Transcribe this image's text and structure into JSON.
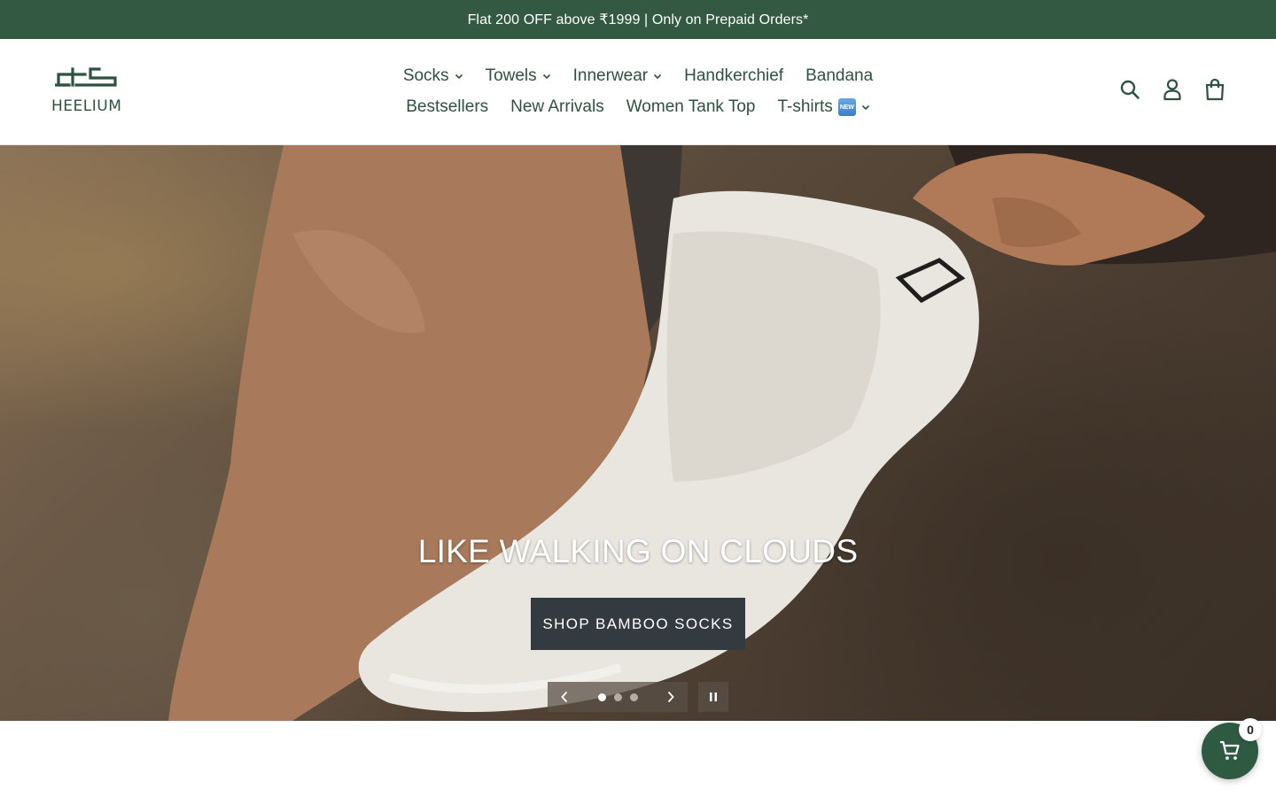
{
  "announcement": {
    "text": "Flat 200 OFF above ₹1999 | Only on Prepaid Orders*"
  },
  "brand": {
    "name": "HEELIUM"
  },
  "nav": {
    "row1": [
      {
        "label": "Socks",
        "dropdown": true
      },
      {
        "label": "Towels",
        "dropdown": true
      },
      {
        "label": "Innerwear",
        "dropdown": true
      },
      {
        "label": "Handkerchief",
        "dropdown": false
      },
      {
        "label": "Bandana",
        "dropdown": false
      }
    ],
    "row2": [
      {
        "label": "Bestsellers",
        "dropdown": false
      },
      {
        "label": "New Arrivals",
        "dropdown": false
      },
      {
        "label": "Women Tank Top",
        "dropdown": false
      },
      {
        "label": "T-shirts",
        "dropdown": true,
        "badge": "NEW"
      }
    ]
  },
  "header_icons": [
    "search-icon",
    "account-icon",
    "cart-icon"
  ],
  "hero": {
    "heading": "LIKE WALKING ON CLOUDS",
    "button_label": "SHOP BAMBOO SOCKS",
    "slides_total": 3,
    "active_slide": 1
  },
  "floating_cart": {
    "count": "0"
  },
  "colors": {
    "announcement_bg": "#345943",
    "brand_green": "#2f5240",
    "hero_button_bg": "#333a40",
    "fab_bg": "#2f5a42"
  }
}
